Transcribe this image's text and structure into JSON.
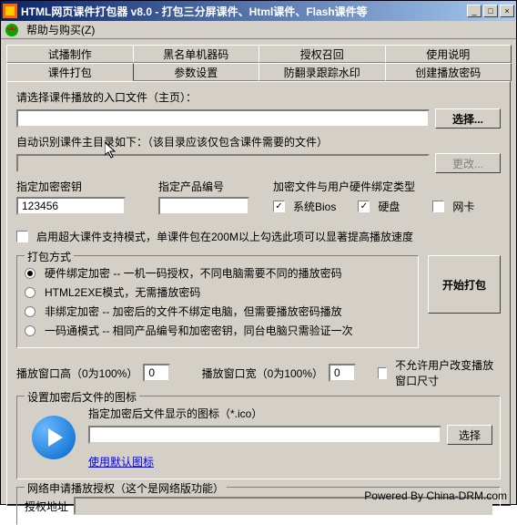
{
  "titlebar": "HTML网页课件打包器 v8.0 - 打包三分屏课件、Html课件、Flash课件等",
  "menu": {
    "help": "帮助与购买(Z)"
  },
  "tabs": {
    "row1": [
      "试播制作",
      "黑名单机器码",
      "授权召回",
      "使用说明"
    ],
    "row2": [
      "课件打包",
      "参数设置",
      "防翻录跟踪水印",
      "创建播放密码"
    ]
  },
  "entry": {
    "label": "请选择课件播放的入口文件（主页）：",
    "value": ""
  },
  "selectBtn": "选择...",
  "autoDir": {
    "label": "自动识别课件主目录如下：（该目录应该仅包含课件需要的文件）",
    "value": ""
  },
  "changeBtn": "更改...",
  "encKey": {
    "label": "指定加密密钥",
    "value": "123456"
  },
  "prodId": {
    "label": "指定产品编号",
    "value": ""
  },
  "bindType": {
    "label": "加密文件与用户硬件绑定类型",
    "bios": "系统Bios",
    "hdd": "硬盘",
    "nic": "网卡"
  },
  "largeMode": "启用超大课件支持模式，单课件包在200M以上勾选此项可以显著提高播放速度",
  "packMode": {
    "title": "打包方式",
    "opt1": "硬件绑定加密 -- 一机一码授权，不同电脑需要不同的播放密码",
    "opt2": "HTML2EXE模式，无需播放密码",
    "opt3": "非绑定加密 -- 加密后的文件不绑定电脑，但需要播放密码播放",
    "opt4": "一码通模式 -- 相同产品编号和加密密钥，同台电脑只需验证一次"
  },
  "startBtn": "开始打包",
  "winHeight": {
    "label": "播放窗口高（0为100%）",
    "value": "0"
  },
  "winWidth": {
    "label": "播放窗口宽（0为100%）",
    "value": "0"
  },
  "lockSize": "不允许用户改变播放窗口尺寸",
  "iconGroup": {
    "title": "设置加密后文件的图标",
    "label": "指定加密后文件显示的图标（*.ico）",
    "value": "",
    "selectBtn": "选择",
    "defaultLink": "使用默认图标"
  },
  "netAuth": {
    "title": "网络申请播放授权（这个是网络版功能）",
    "label": "授权地址",
    "value": ""
  },
  "footer": "Powered By China-DRM.com"
}
